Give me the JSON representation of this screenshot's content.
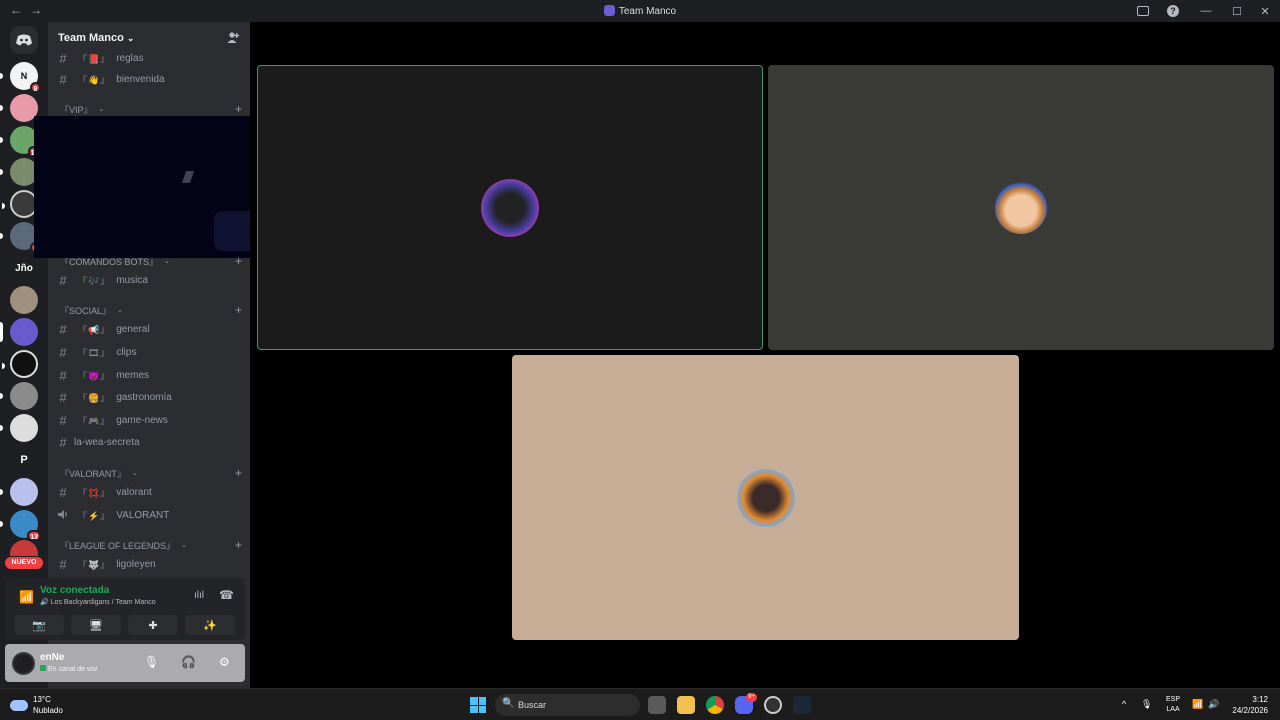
{
  "window": {
    "title": "Team Manco",
    "nav_back": "←",
    "nav_forward": "→",
    "min": "—",
    "max": "☐",
    "close": "✕",
    "help": "?"
  },
  "server": {
    "name": "Team Manco",
    "chev": "⌄",
    "invite_icon": "👤+"
  },
  "guilds": {
    "text_1": "Jño",
    "text_2": "P",
    "badges": [
      "8",
      "11",
      "2",
      "13"
    ],
    "nuevo": "NUEVO"
  },
  "channels": {
    "c_reglas": {
      "emoji": "『📕』",
      "name": "reglas"
    },
    "c_bienvenida": {
      "emoji": "『👋』",
      "name": "bienvenida"
    },
    "cat_vip": "『VIP』",
    "cat_bots": "『COMANDOS BOTS』",
    "c_musica": {
      "emoji": "『🎶』",
      "name": "musica"
    },
    "cat_social": "『SOCIAL』",
    "c_general": {
      "emoji": "『📢』",
      "name": "general"
    },
    "c_clips": {
      "emoji": "『🎞』",
      "name": "clips"
    },
    "c_memes": {
      "emoji": "『😈』",
      "name": "memes"
    },
    "c_gastronomia": {
      "emoji": "『🍔』",
      "name": "gastronomía"
    },
    "c_gamenews": {
      "emoji": "『🎮』",
      "name": "game-news"
    },
    "c_laweasecreta": {
      "name": "la-wea-secreta"
    },
    "cat_valorant": "『VALORANT』",
    "c_valorant": {
      "emoji": "『💢』",
      "name": "valorant"
    },
    "c_valorant_voice": {
      "emoji": "『⚡』",
      "name": "VALORANT"
    },
    "cat_lol": "『LEAGUE OF LEGENDS』",
    "c_ligoleyen": {
      "emoji": "『🐺』",
      "name": "ligoleyen"
    },
    "hash": "#",
    "plus": "+",
    "cat_chev": "⌄"
  },
  "voice": {
    "status": "Voz conectada",
    "channel": "🔊 Los Backyardigans / Team Manco",
    "signal_icon": "📶",
    "wave_icon": "ılıl",
    "hangup_icon": "☎"
  },
  "voice_buttons": {
    "camera": "📷",
    "screen": "🖥",
    "activity": "✚",
    "soundboard": "✨"
  },
  "user": {
    "name": "enNe",
    "status": "En canal de voz",
    "mic": "🎙",
    "headset": "🎧",
    "settings": "⚙"
  },
  "taskbar": {
    "temp": "13°C",
    "weather": "Nublado",
    "search": "Buscar",
    "search_icon": "🔍",
    "discord_badge": "9+",
    "lang_1": "ESP",
    "lang_2": "LAA",
    "time": "3:12",
    "date": "24/2/2026",
    "tray_up": "^",
    "tray_mic": "🎙",
    "tray_wifi": "📶",
    "tray_vol": "🔊"
  },
  "colors": {
    "accent_green": "#23a55a",
    "badge_red": "#f23f43",
    "discord_blurple": "#5865f2"
  }
}
